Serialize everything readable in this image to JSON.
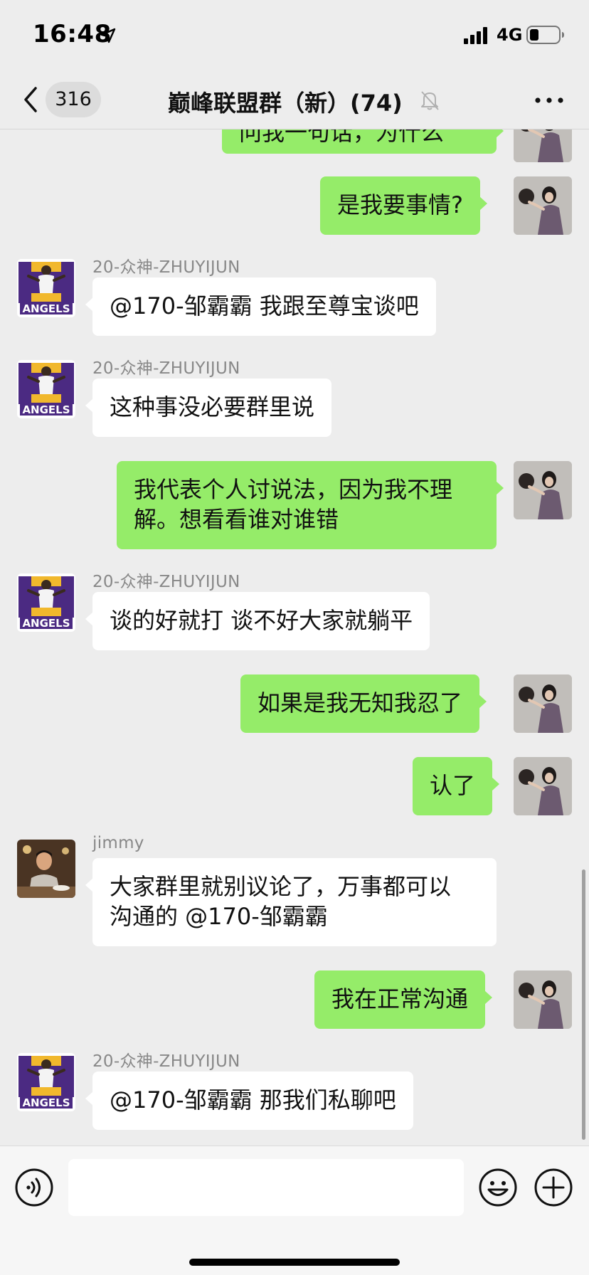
{
  "status_bar": {
    "time": "16:48",
    "network": "4G"
  },
  "nav": {
    "unread_count": "316",
    "title": "巅峰联盟群（新）(74)"
  },
  "messages": [
    {
      "side": "out",
      "text": "问我一句话，为什么",
      "avatar": "girl-photo-avatar"
    },
    {
      "side": "out",
      "text": "是我要事情?",
      "avatar": "girl-photo-avatar"
    },
    {
      "side": "in",
      "sender": "20-众神-ZHUYIJUN",
      "text": "@170-邹霸霸 我跟至尊宝谈吧",
      "avatar": "angels-logo-avatar"
    },
    {
      "side": "in",
      "sender": "20-众神-ZHUYIJUN",
      "text": "这种事没必要群里说",
      "avatar": "angels-logo-avatar"
    },
    {
      "side": "out",
      "lines": [
        "我代表个人讨说法，因为我不理",
        "解。想看看谁对谁错"
      ],
      "avatar": "girl-photo-avatar"
    },
    {
      "side": "in",
      "sender": "20-众神-ZHUYIJUN",
      "text": "谈的好就打 谈不好大家就躺平",
      "avatar": "angels-logo-avatar"
    },
    {
      "side": "out",
      "text": "如果是我无知我忍了",
      "avatar": "girl-photo-avatar"
    },
    {
      "side": "out",
      "text": "认了",
      "avatar": "girl-photo-avatar"
    },
    {
      "side": "in",
      "sender": "jimmy",
      "lines": [
        "大家群里就别议论了，万事都可以",
        "沟通的 @170-邹霸霸"
      ],
      "avatar": "man-photo-avatar"
    },
    {
      "side": "out",
      "text": "我在正常沟通",
      "avatar": "girl-photo-avatar"
    },
    {
      "side": "in",
      "sender": "20-众神-ZHUYIJUN",
      "text": "@170-邹霸霸 那我们私聊吧",
      "avatar": "angels-logo-avatar"
    }
  ],
  "angels_logo_text": "ANGELS",
  "input": {
    "placeholder": ""
  },
  "colors": {
    "background": "#ededed",
    "outgoing_bubble": "#95ec69",
    "incoming_bubble": "#ffffff",
    "angels_purple": "#4b2a82",
    "angels_gold": "#f1b82d"
  }
}
